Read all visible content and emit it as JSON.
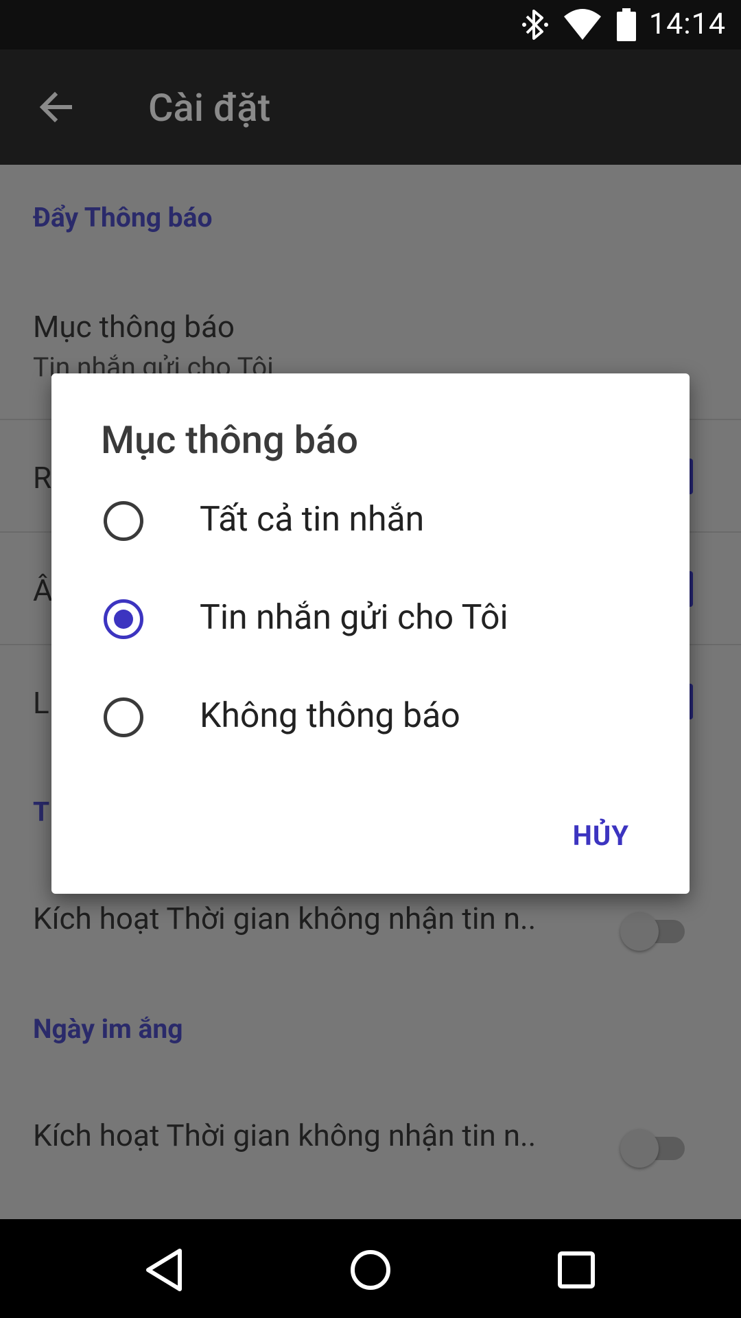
{
  "status_bar": {
    "time": "14:14",
    "icons": [
      "bluetooth-icon",
      "wifi-icon",
      "battery-icon"
    ]
  },
  "app_bar": {
    "title": "Cài đặt",
    "back_icon": "arrow-back-icon"
  },
  "settings": {
    "section_push": "Đẩy Thông báo",
    "notification_item_title": "Mục thông báo",
    "notification_item_value": "Tin nhắn gửi cho Tôi",
    "row2_letter": "R",
    "row3_letter": "Â",
    "row4_letter": "L",
    "section_t_letter": "T",
    "quiet_time_label": "Kích hoạt Thời gian không nhận tin n..",
    "section_quiet_days": "Ngày im ắng",
    "quiet_days_label": "Kích hoạt Thời gian không nhận tin n.."
  },
  "dialog": {
    "title": "Mục thông báo",
    "options": [
      {
        "label": "Tất cả tin nhắn",
        "checked": false
      },
      {
        "label": "Tin nhắn gửi cho Tôi",
        "checked": true
      },
      {
        "label": "Không thông báo",
        "checked": false
      }
    ],
    "cancel_label": "HỦY"
  },
  "nav_bar": {
    "buttons": [
      "back-triangle-icon",
      "home-circle-icon",
      "recents-square-icon"
    ]
  },
  "colors": {
    "accent": "#3c34c0",
    "appbar": "#1a1a1a",
    "statusbar": "#0f0f0f"
  }
}
